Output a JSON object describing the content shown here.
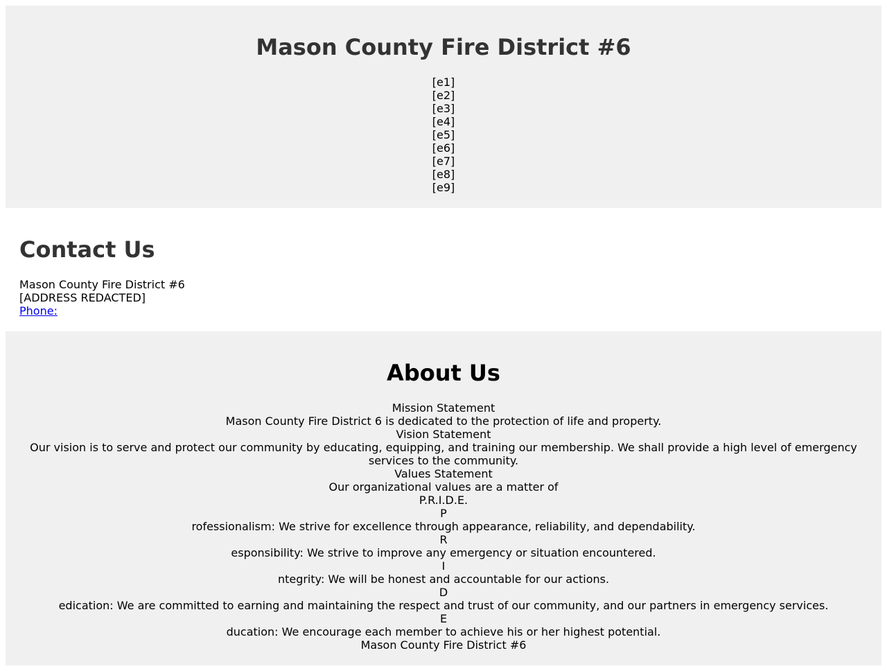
{
  "header": {
    "title": "Mason County Fire District #6",
    "nav_items": [
      "[e1]",
      "[e2]",
      "[e3]",
      "[e4]",
      "[e5]",
      "[e6]",
      "[e7]",
      "[e8]",
      "[e9]"
    ]
  },
  "contact": {
    "heading": "Contact Us",
    "name": "Mason County Fire District #6",
    "address": "[ADDRESS REDACTED]",
    "phone_link": "Phone:"
  },
  "about": {
    "heading": "About Us",
    "mission_title": "Mission Statement",
    "mission_text": "Mason County Fire District 6 is dedicated to the protection of life and property.",
    "vision_title": "Vision Statement",
    "vision_text": "Our vision is to serve and protect our community by educating, equipping, and training our membership. We shall provide a high level of emergency services to the community.",
    "values_title": "Values Statement",
    "values_intro": "Our organizational values are a matter of",
    "values_acronym": "P.R.I.D.E.",
    "values": [
      {
        "letter": "P",
        "text": "rofessionalism: We strive for excellence through appearance, reliability, and dependability."
      },
      {
        "letter": "R",
        "text": "esponsibility: We strive to improve any emergency or situation encountered."
      },
      {
        "letter": "I",
        "text": "ntegrity: We will be honest and accountable for our actions."
      },
      {
        "letter": "D",
        "text": "edication: We are committed to earning and maintaining the respect and trust of our community, and our partners in emergency services."
      },
      {
        "letter": "E",
        "text": "ducation: We encourage each member to achieve his or her highest potential."
      }
    ],
    "footer_name": "Mason County Fire District #6"
  },
  "colors": {
    "section_background": "#f0f0f0",
    "heading_text": "#333333",
    "link": "#0000ee"
  }
}
